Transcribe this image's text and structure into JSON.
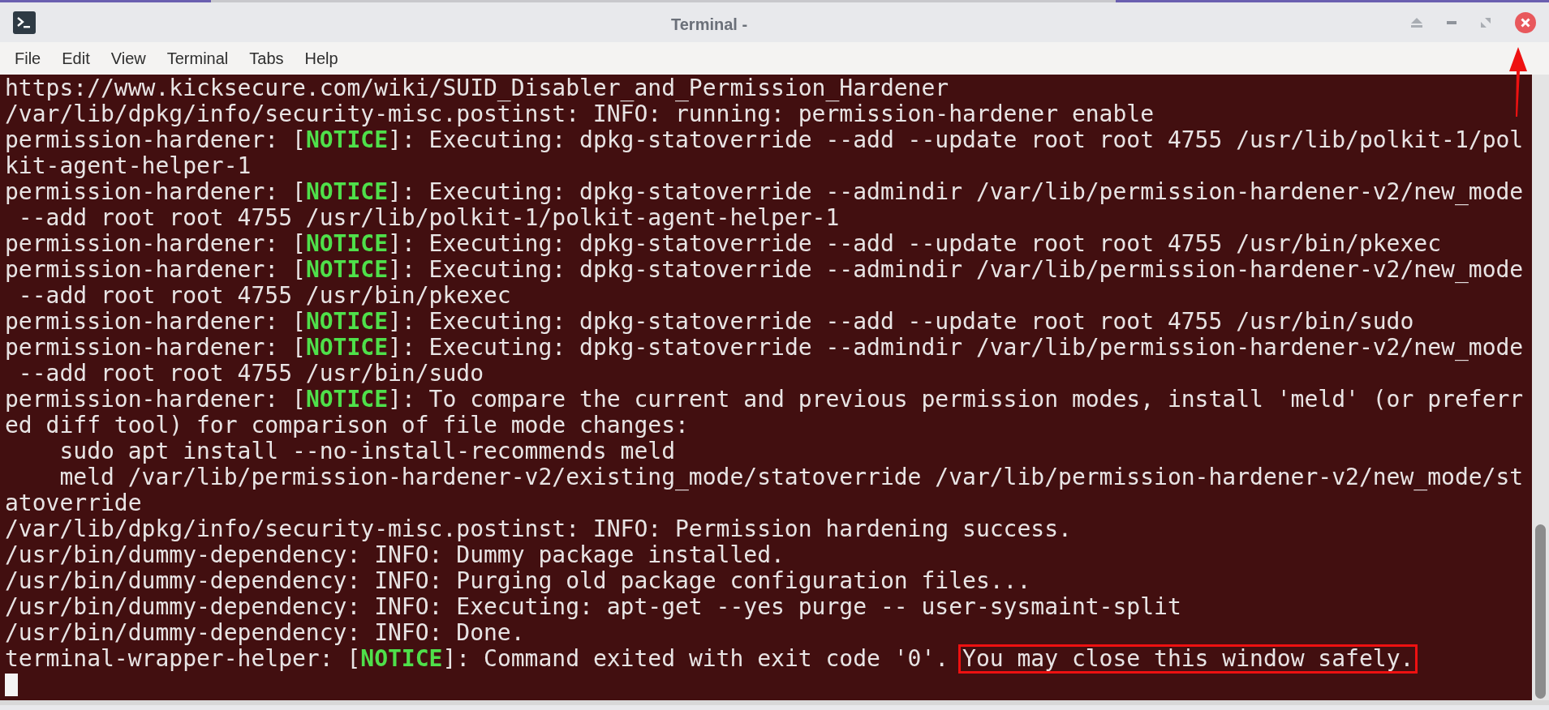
{
  "window": {
    "title": "Terminal -"
  },
  "menu": [
    "File",
    "Edit",
    "View",
    "Terminal",
    "Tabs",
    "Help"
  ],
  "terminal": {
    "lines": [
      [
        {
          "text": "https://www.kicksecure.com/wiki/SUID_Disabler_and_Permission_Hardener"
        }
      ],
      [
        {
          "text": "/var/lib/dpkg/info/security-misc.postinst: INFO: running: permission-hardener enable"
        }
      ],
      [
        {
          "text": "permission-hardener: ["
        },
        {
          "text": "NOTICE",
          "kind": "notice"
        },
        {
          "text": "]: Executing: dpkg-statoverride --add --update root root 4755 /usr/lib/polkit-1/pol"
        }
      ],
      [
        {
          "text": "kit-agent-helper-1"
        }
      ],
      [
        {
          "text": "permission-hardener: ["
        },
        {
          "text": "NOTICE",
          "kind": "notice"
        },
        {
          "text": "]: Executing: dpkg-statoverride --admindir /var/lib/permission-hardener-v2/new_mode"
        }
      ],
      [
        {
          "text": " --add root root 4755 /usr/lib/polkit-1/polkit-agent-helper-1"
        }
      ],
      [
        {
          "text": "permission-hardener: ["
        },
        {
          "text": "NOTICE",
          "kind": "notice"
        },
        {
          "text": "]: Executing: dpkg-statoverride --add --update root root 4755 /usr/bin/pkexec"
        }
      ],
      [
        {
          "text": "permission-hardener: ["
        },
        {
          "text": "NOTICE",
          "kind": "notice"
        },
        {
          "text": "]: Executing: dpkg-statoverride --admindir /var/lib/permission-hardener-v2/new_mode"
        }
      ],
      [
        {
          "text": " --add root root 4755 /usr/bin/pkexec"
        }
      ],
      [
        {
          "text": "permission-hardener: ["
        },
        {
          "text": "NOTICE",
          "kind": "notice"
        },
        {
          "text": "]: Executing: dpkg-statoverride --add --update root root 4755 /usr/bin/sudo"
        }
      ],
      [
        {
          "text": "permission-hardener: ["
        },
        {
          "text": "NOTICE",
          "kind": "notice"
        },
        {
          "text": "]: Executing: dpkg-statoverride --admindir /var/lib/permission-hardener-v2/new_mode"
        }
      ],
      [
        {
          "text": " --add root root 4755 /usr/bin/sudo"
        }
      ],
      [
        {
          "text": "permission-hardener: ["
        },
        {
          "text": "NOTICE",
          "kind": "notice"
        },
        {
          "text": "]: To compare the current and previous permission modes, install 'meld' (or preferr"
        }
      ],
      [
        {
          "text": "ed diff tool) for comparison of file mode changes:"
        }
      ],
      [
        {
          "text": "    sudo apt install --no-install-recommends meld"
        }
      ],
      [
        {
          "text": "    meld /var/lib/permission-hardener-v2/existing_mode/statoverride /var/lib/permission-hardener-v2/new_mode/st"
        }
      ],
      [
        {
          "text": "atoverride"
        }
      ],
      [
        {
          "text": "/var/lib/dpkg/info/security-misc.postinst: INFO: Permission hardening success."
        }
      ],
      [
        {
          "text": "/usr/bin/dummy-dependency: INFO: Dummy package installed."
        }
      ],
      [
        {
          "text": "/usr/bin/dummy-dependency: INFO: Purging old package configuration files..."
        }
      ],
      [
        {
          "text": "/usr/bin/dummy-dependency: INFO: Executing: apt-get --yes purge -- user-sysmaint-split"
        }
      ],
      [
        {
          "text": "/usr/bin/dummy-dependency: INFO: Done."
        }
      ],
      [
        {
          "text": "terminal-wrapper-helper: ["
        },
        {
          "text": "NOTICE",
          "kind": "notice"
        },
        {
          "text": "]: Command exited with exit code '0'. "
        },
        {
          "text": "You may close this window safely.",
          "kind": "highlight"
        }
      ]
    ],
    "cursor": true
  }
}
